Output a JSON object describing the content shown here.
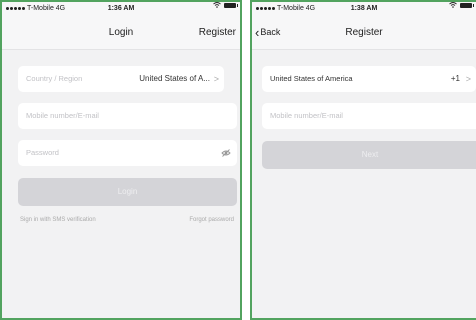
{
  "login_screen": {
    "status": {
      "carrier": "T-Mobile 4G",
      "time": "1:36 AM"
    },
    "nav": {
      "title": "Login",
      "right_action": "Register"
    },
    "country": {
      "placeholder": "Country / Region",
      "value": "United States of A...",
      "arrow": ">"
    },
    "account": {
      "placeholder": "Mobile number/E-mail"
    },
    "password": {
      "placeholder": "Password"
    },
    "submit_label": "Login",
    "sms_link": "Sign in with SMS verification",
    "forgot_link": "Forgot password"
  },
  "register_screen": {
    "status": {
      "carrier": "T-Mobile 4G",
      "time": "1:38 AM"
    },
    "nav": {
      "back_label": "Back",
      "title": "Register"
    },
    "country": {
      "value": "United States of America",
      "code": "+1",
      "arrow": ">"
    },
    "account": {
      "placeholder": "Mobile number/E-mail"
    },
    "next_label": "Next"
  },
  "icons": {
    "back": "chevron-left-icon",
    "eye": "eye-slash-icon",
    "wifi": "wifi-icon",
    "battery": "battery-icon",
    "signal": "signal-dots-icon"
  },
  "colors": {
    "frame_border": "#52a35f",
    "screen_background": "#f2f2f3",
    "disabled_button": "#d4d4d8"
  }
}
